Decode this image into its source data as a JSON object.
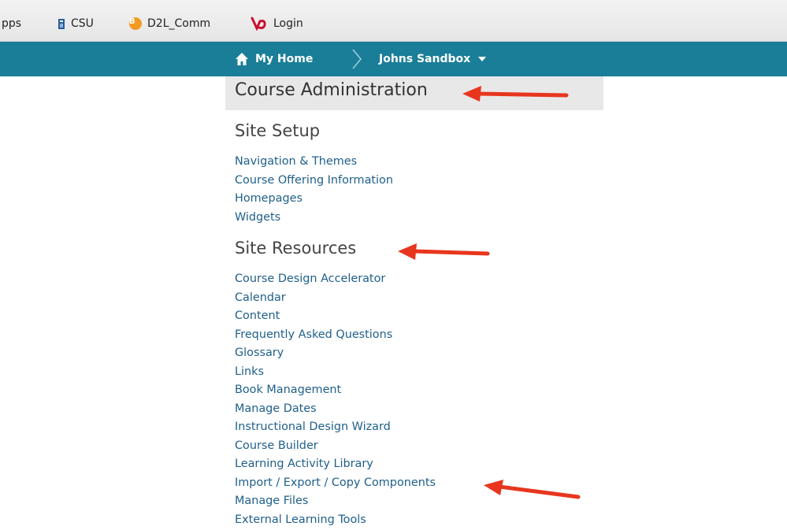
{
  "bookmarks": [
    {
      "label": "pps",
      "icon": "none"
    },
    {
      "label": "CSU",
      "icon": "book-icon"
    },
    {
      "label": "D2L_Comm",
      "icon": "orange-circle-icon",
      "glyph": "B"
    },
    {
      "label": "Login",
      "icon": "d2l-logo-icon"
    }
  ],
  "nav": {
    "home_label": "My Home",
    "course_label": "Johns Sandbox"
  },
  "panel": {
    "title": "Course Administration",
    "sections": [
      {
        "title": "Site Setup",
        "links": [
          "Navigation & Themes",
          "Course Offering Information",
          "Homepages",
          "Widgets"
        ]
      },
      {
        "title": "Site Resources",
        "links": [
          "Course Design Accelerator",
          "Calendar",
          "Content",
          "Frequently Asked Questions",
          "Glossary",
          "Links",
          "Book Management",
          "Manage Dates",
          "Instructional Design Wizard",
          "Course Builder",
          "Learning Activity Library",
          "Import / Export / Copy Components",
          "Manage Files",
          "External Learning Tools"
        ]
      }
    ]
  },
  "colors": {
    "navbar": "#1a7e98",
    "link": "#1f5f8a",
    "arrow": "#e8361e",
    "header_bg": "#e8e8e8"
  }
}
